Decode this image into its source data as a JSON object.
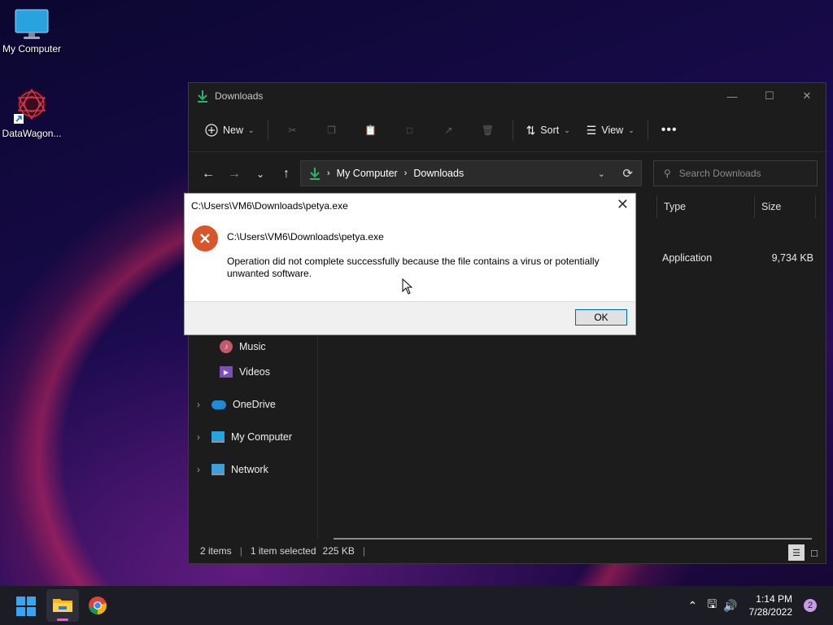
{
  "desktop": {
    "icons": [
      {
        "label": "My Computer"
      },
      {
        "label": "DataWagon..."
      }
    ]
  },
  "explorer": {
    "title": "Downloads",
    "toolbar": {
      "new_label": "New",
      "sort_label": "Sort",
      "view_label": "View"
    },
    "breadcrumb": [
      "My Computer",
      "Downloads"
    ],
    "search_placeholder": "Search Downloads",
    "columns": {
      "type": "Type",
      "size": "Size"
    },
    "file_row": {
      "type": "Application",
      "size": "9,734 KB"
    },
    "nav": {
      "music": "Music",
      "videos": "Videos",
      "onedrive": "OneDrive",
      "mycomputer": "My Computer",
      "network": "Network"
    },
    "status": {
      "items": "2 items",
      "selected": "1 item selected",
      "size": "225 KB"
    }
  },
  "dialog": {
    "title": "C:\\Users\\VM6\\Downloads\\petya.exe",
    "heading": "C:\\Users\\VM6\\Downloads\\petya.exe",
    "message": "Operation did not complete successfully because the file contains a virus or potentially unwanted software.",
    "ok_label": "OK"
  },
  "taskbar": {
    "time": "1:14 PM",
    "date": "7/28/2022",
    "notification_count": "2"
  },
  "colors": {
    "accent": "#0067c0",
    "error": "#d9562a",
    "download_green": "#2fb36a"
  }
}
